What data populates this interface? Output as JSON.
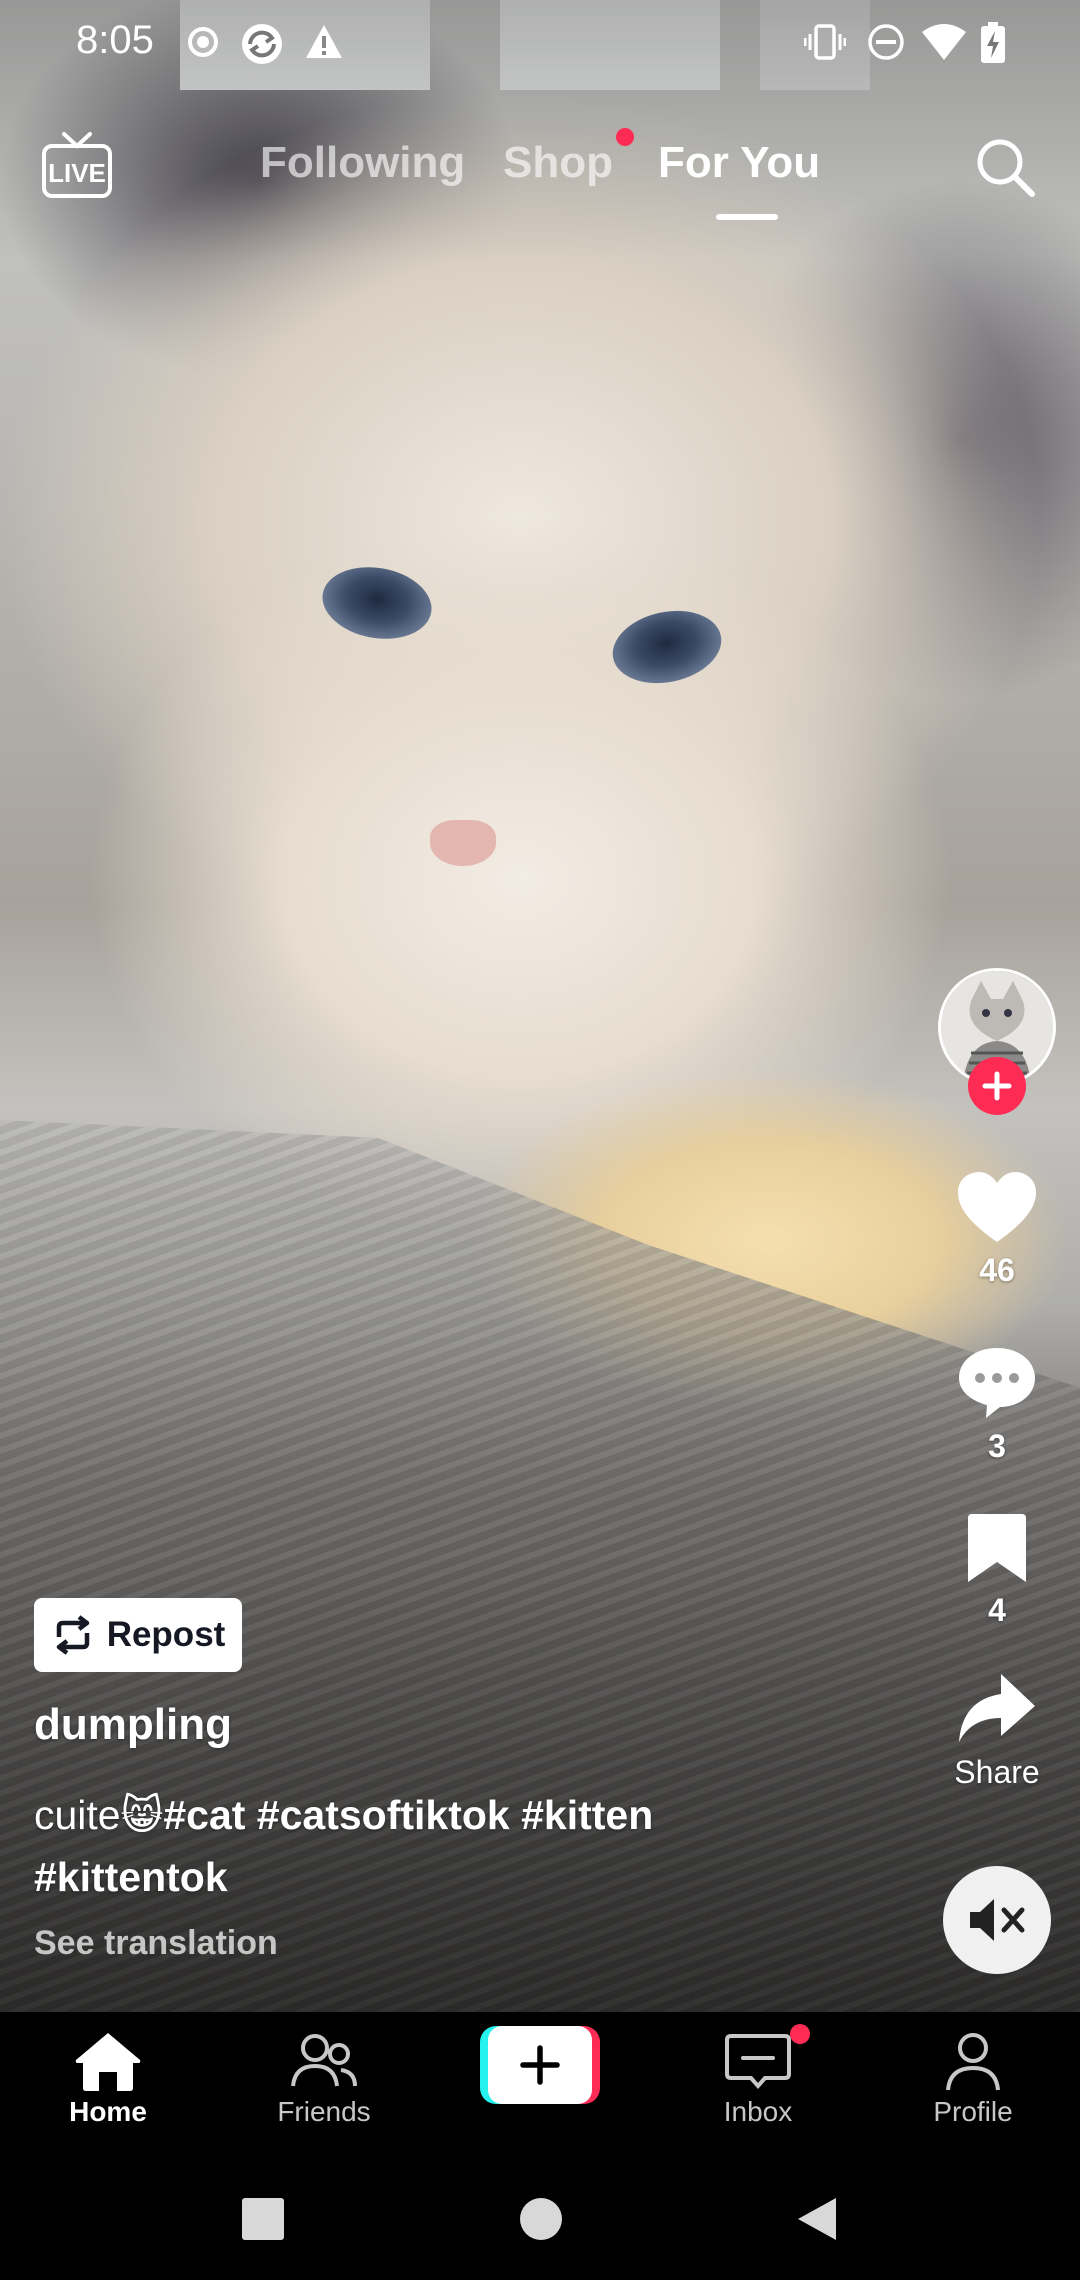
{
  "status_bar": {
    "time": "8:05",
    "left_icons": [
      "radio-button-icon",
      "sync-app-icon",
      "warning-icon"
    ],
    "right_icons": [
      "vibrate-icon",
      "do-not-disturb-icon",
      "wifi-icon",
      "battery-charging-icon"
    ]
  },
  "top_nav": {
    "live_icon": "live-tv-icon",
    "tabs": [
      {
        "label": "Following",
        "active": false
      },
      {
        "label": "Shop",
        "active": false,
        "has_dot": true
      },
      {
        "label": "For You",
        "active": true
      }
    ],
    "search_icon": "search-icon"
  },
  "video": {
    "creator_avatar": "cat-avatar",
    "follow_icon": "plus-icon",
    "actions": {
      "like": {
        "icon": "heart-icon",
        "count": "46"
      },
      "comment": {
        "icon": "comment-bubble-icon",
        "count": "3"
      },
      "bookmark": {
        "icon": "bookmark-icon",
        "count": "4"
      },
      "share": {
        "icon": "share-arrow-icon",
        "label": "Share"
      }
    },
    "mute_icon": "speaker-muted-icon",
    "repost_label": "Repost",
    "username": "dumpling",
    "caption": {
      "text": "cuite😸",
      "hashtags_line1": "#cat #catsoftiktok #kitten",
      "hashtags_line2": "#kittentok"
    },
    "see_translation": "See translation"
  },
  "bottom_nav": {
    "items": [
      {
        "label": "Home",
        "icon": "home-icon",
        "active": true
      },
      {
        "label": "Friends",
        "icon": "friends-icon",
        "active": false
      },
      {
        "label": "",
        "icon": "create-plus-icon",
        "active": false
      },
      {
        "label": "Inbox",
        "icon": "inbox-icon",
        "active": false,
        "has_dot": true
      },
      {
        "label": "Profile",
        "icon": "profile-icon",
        "active": false
      }
    ]
  },
  "system_nav": [
    "recents-square-icon",
    "home-circle-icon",
    "back-triangle-icon"
  ],
  "colors": {
    "accent": "#fe2c55",
    "create_cyan": "#25f4ee",
    "nav_bg": "#000000"
  }
}
